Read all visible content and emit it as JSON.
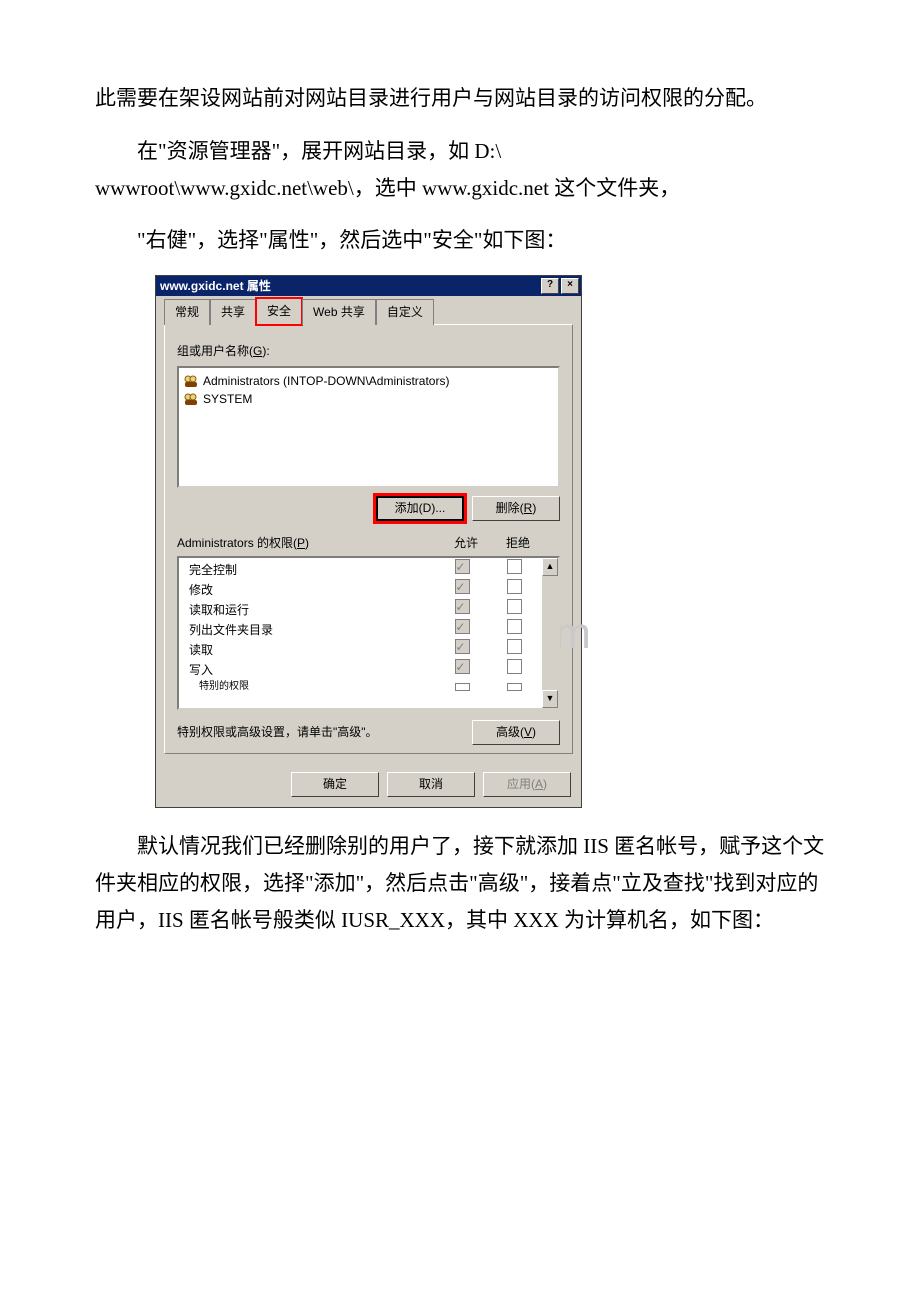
{
  "paragraphs": {
    "p1": "此需要在架设网站前对网站目录进行用户与网站目录的访问权限的分配。",
    "p2a": "在\"资源管理器\"，展开网站目录，如 D:\\",
    "p2b": "wwwroot\\www.gxidc.net\\web\\，选中 www.gxidc.net 这个文件夹，",
    "p3": "\"右健\"，选择\"属性\"，然后选中\"安全\"如下图：",
    "p4": "默认情况我们已经删除别的用户了，接下就添加 IIS 匿名帐号，赋予这个文件夹相应的权限，选择\"添加\"，然后点击\"高级\"，接着点\"立及查找\"找到对应的用户，IIS 匿名帐号般类似 IUSR_XXX，其中 XXX 为计算机名，如下图："
  },
  "watermark": "www.b   o  .com",
  "dialog": {
    "title": "www.gxidc.net 属性",
    "help_btn": "?",
    "close_btn": "×",
    "tabs": {
      "general": "常规",
      "share": "共享",
      "security": "安全",
      "webshare": "Web 共享",
      "custom": "自定义"
    },
    "group_label_pre": "组或用户名称(",
    "group_label_u": "G",
    "group_label_post": "):",
    "users": {
      "admins": "Administrators (INTOP-DOWN\\Administrators)",
      "system": "SYSTEM"
    },
    "add_btn": "添加(D)...",
    "remove_btn_pre": "删除(",
    "remove_btn_u": "R",
    "remove_btn_post": ")",
    "perm_label_pre": "Administrators 的权限(",
    "perm_label_u": "P",
    "perm_label_post": ")",
    "allow": "允许",
    "deny": "拒绝",
    "perms": {
      "full": "完全控制",
      "modify": "修改",
      "readexec": "读取和运行",
      "listdir": "列出文件夹目录",
      "read": "读取",
      "write": "写入",
      "special": "特别的权限"
    },
    "adv_text": "特别权限或高级设置，请单击\"高级\"。",
    "adv_btn_pre": "高级(",
    "adv_btn_u": "V",
    "adv_btn_post": ")",
    "ok": "确定",
    "cancel": "取消",
    "apply_pre": "应用(",
    "apply_u": "A",
    "apply_post": ")"
  }
}
